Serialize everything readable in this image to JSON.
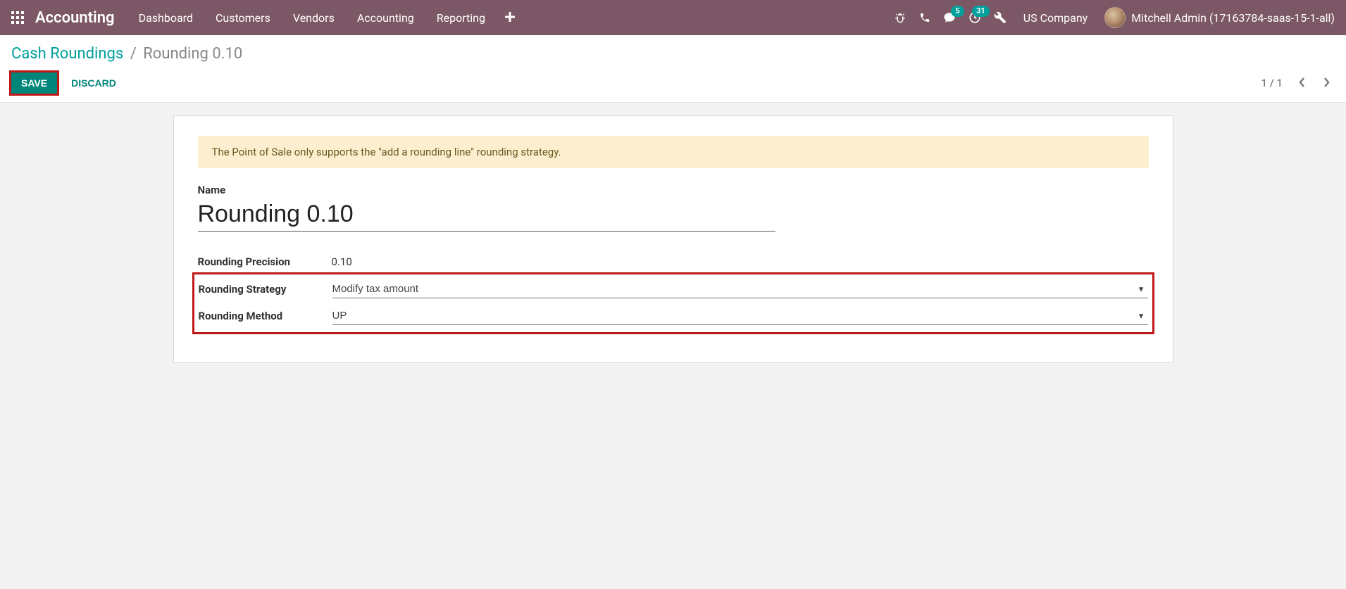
{
  "navbar": {
    "brand": "Accounting",
    "menu": [
      "Dashboard",
      "Customers",
      "Vendors",
      "Accounting",
      "Reporting"
    ],
    "messages_badge": "5",
    "activities_badge": "31",
    "company": "US Company",
    "user_name": "Mitchell Admin (17163784-saas-15-1-all)"
  },
  "breadcrumb": {
    "parent": "Cash Roundings",
    "current": "Rounding 0.10"
  },
  "buttons": {
    "save": "Save",
    "discard": "Discard"
  },
  "pager": {
    "text": "1 / 1"
  },
  "alert": "The Point of Sale only supports the \"add a rounding line\" rounding strategy.",
  "fields": {
    "name_label": "Name",
    "name_value": "Rounding 0.10",
    "precision_label": "Rounding Precision",
    "precision_value": "0.10",
    "strategy_label": "Rounding Strategy",
    "strategy_value": "Modify tax amount",
    "method_label": "Rounding Method",
    "method_value": "UP"
  }
}
